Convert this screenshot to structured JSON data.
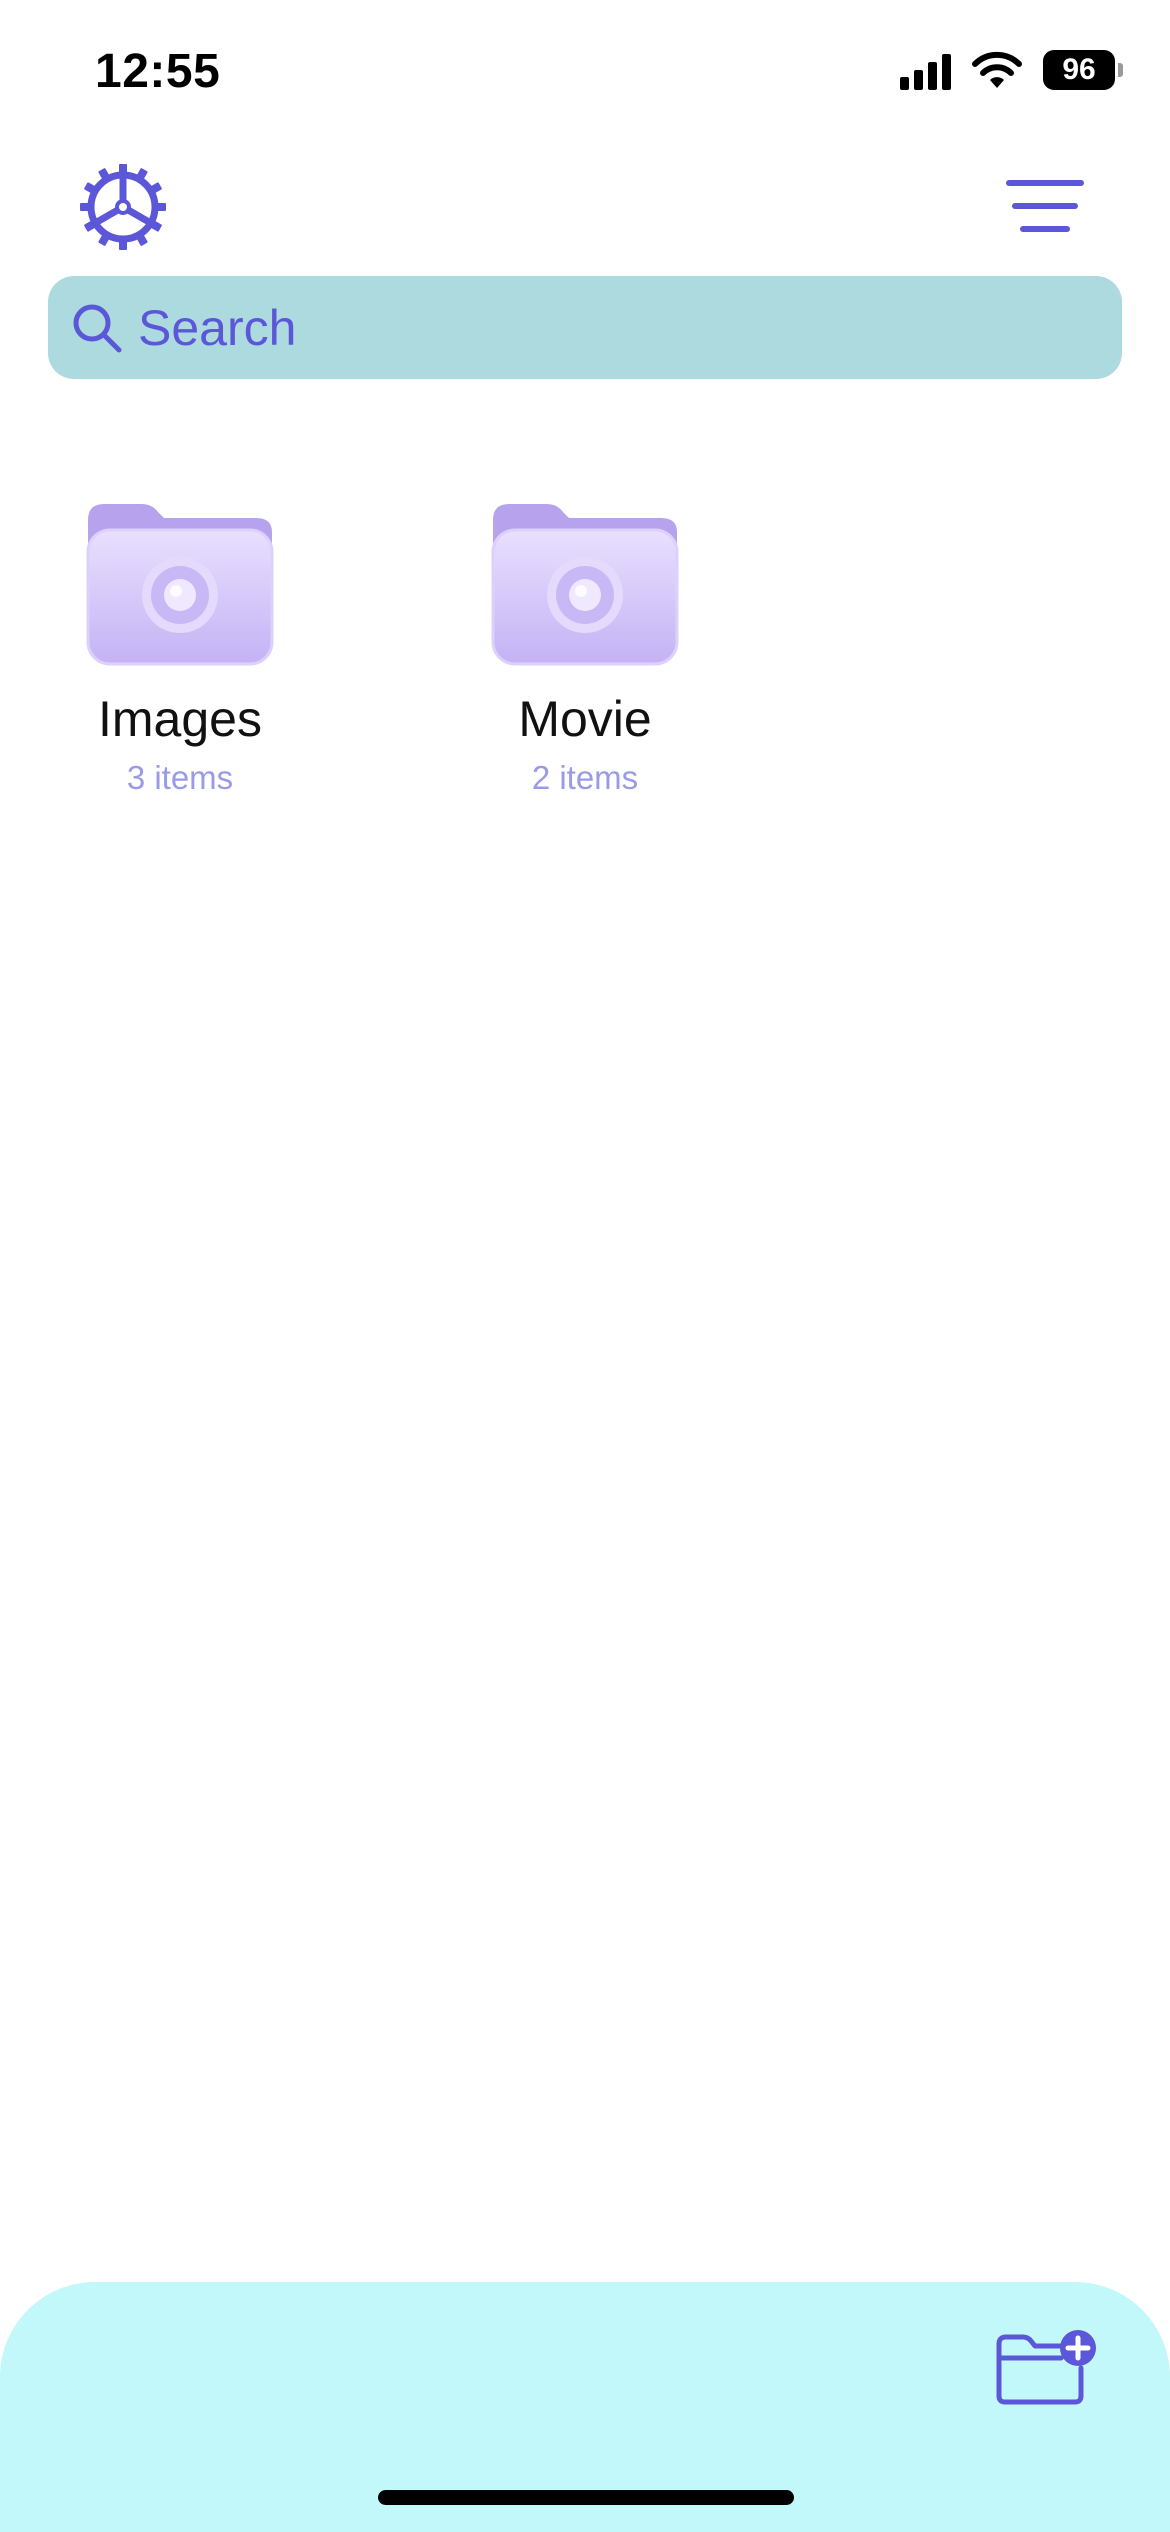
{
  "status_bar": {
    "time": "12:55",
    "battery": "96",
    "icons": [
      "cellular-signal-icon",
      "wifi-icon",
      "battery-icon"
    ]
  },
  "header": {
    "settings_icon": "gear-icon",
    "menu_icon": "hamburger-menu-icon"
  },
  "search": {
    "placeholder": "Search",
    "value": ""
  },
  "folders": [
    {
      "name": "Images",
      "count": "3 items",
      "icon": "camera-folder-icon"
    },
    {
      "name": "Movie",
      "count": "2 items",
      "icon": "camera-folder-icon"
    }
  ],
  "bottom_bar": {
    "new_folder_icon": "folder-plus-icon"
  },
  "colors": {
    "accent": "#5b57d8",
    "search_bg": "#acdadf",
    "bottom_bar_bg": "#c3f8fb",
    "folder_purple": "#c6b6f5",
    "secondary_text": "#9a9be6"
  }
}
